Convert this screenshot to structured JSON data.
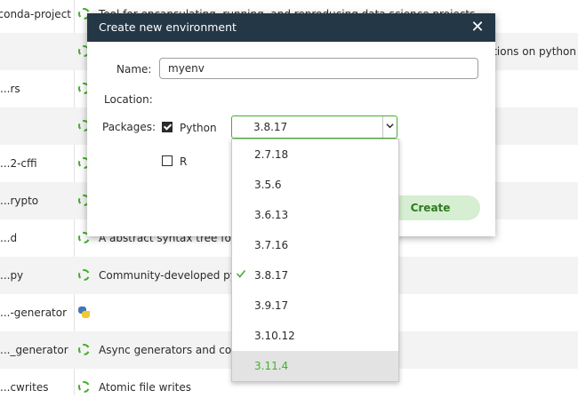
{
  "background_list": {
    "rows": [
      {
        "name": "conda-project",
        "desc": "Tool for encapsulating, running, and reproducing data science projects",
        "icon": "loading-ring-icon"
      },
      {
        "name": "",
        "desc": "…ations on python",
        "icon": "loading-ring-icon"
      },
      {
        "name": "...rs",
        "desc": "",
        "icon": "loading-ring-icon"
      },
      {
        "name": "",
        "desc": "",
        "icon": "loading-ring-icon"
      },
      {
        "name": "...2-cffi",
        "desc": "",
        "icon": "loading-ring-icon"
      },
      {
        "name": "...rypto",
        "desc": "",
        "icon": "loading-ring-icon"
      },
      {
        "name": "...d",
        "desc": "A abstract syntax tree for p",
        "icon": "loading-ring-icon"
      },
      {
        "name": "...py",
        "desc": "Community-developed pyt",
        "icon": "loading-ring-icon"
      },
      {
        "name": "...-generator",
        "desc": "",
        "icon": "python-logo-icon"
      },
      {
        "name": "..._generator",
        "desc": "Async generators and conte",
        "icon": "loading-ring-icon"
      },
      {
        "name": "...cwrites",
        "desc": "Atomic file writes",
        "icon": "loading-ring-icon"
      }
    ]
  },
  "dialog": {
    "title": "Create new environment",
    "close_label": "✕",
    "name_label": "Name:",
    "name_value": "myenv",
    "location_label": "Location:",
    "packages_label": "Packages:",
    "python_label": "Python",
    "python_checked": true,
    "r_label": "R",
    "r_checked": false,
    "selected_version": "3.8.17",
    "create_label": "Create"
  },
  "dropdown": {
    "options": [
      "2.7.18",
      "3.5.6",
      "3.6.13",
      "3.7.16",
      "3.8.17",
      "3.9.17",
      "3.10.12",
      "3.11.4"
    ],
    "selected": "3.8.17",
    "hovered": "3.11.4"
  },
  "colors": {
    "header_bg": "#243746",
    "accent_green": "#43b02a",
    "create_bg": "#d6eed1"
  }
}
